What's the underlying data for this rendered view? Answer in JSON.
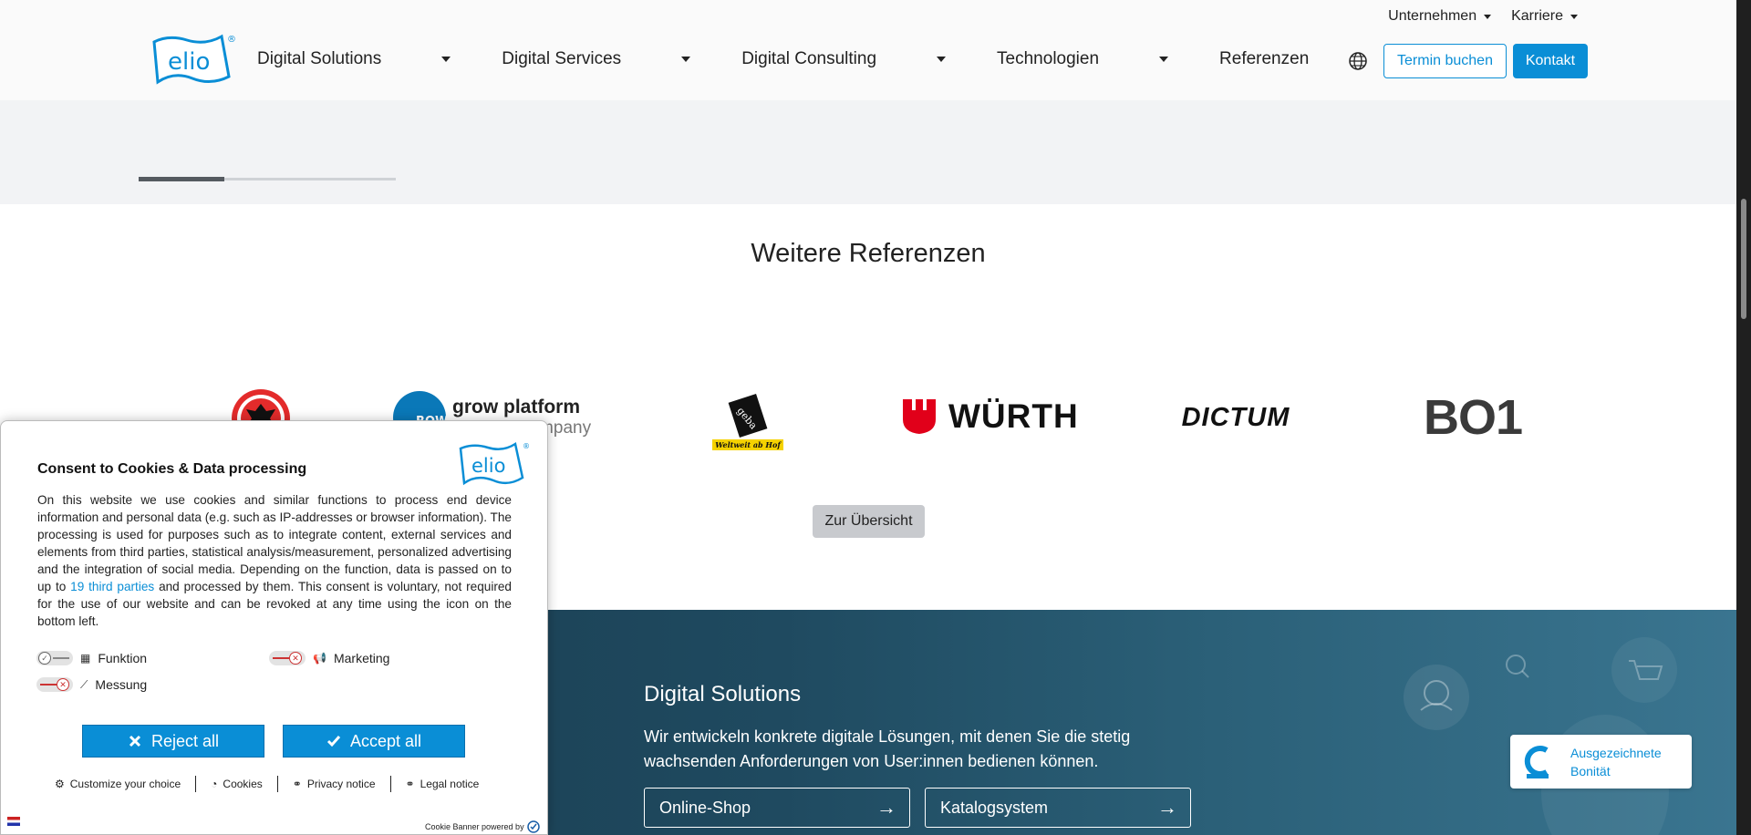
{
  "header": {
    "topnav": [
      {
        "label": "Unternehmen"
      },
      {
        "label": "Karriere"
      }
    ],
    "mainnav": [
      {
        "label": "Digital Solutions"
      },
      {
        "label": "Digital Services"
      },
      {
        "label": "Digital Consulting"
      },
      {
        "label": "Technologien"
      },
      {
        "label": "Referenzen"
      }
    ],
    "logo_text": "elio",
    "appointment_button": "Termin buchen",
    "contact_button": "Kontakt"
  },
  "references": {
    "title": "Weitere Referenzen",
    "logos": [
      {
        "name": "eintracht-frankfurt"
      },
      {
        "name": "grow platform",
        "title": "grow platform",
        "subtitle": "A Bosch company"
      },
      {
        "name": "gebana",
        "tagline": "Weltweit ab Hof"
      },
      {
        "name": "wurth",
        "text": "WÜRTH"
      },
      {
        "name": "dictum",
        "text": "DICTUM"
      },
      {
        "name": "bo1",
        "text": "BO1"
      }
    ],
    "overview_button": "Zur Übersicht"
  },
  "digital_solutions": {
    "title": "Digital Solutions",
    "text": "Wir entwickeln konkrete digitale Lösungen, mit denen Sie die stetig wachsenden Anforderungen von User:innen bedienen können.",
    "buttons": [
      {
        "label": "Online-Shop"
      },
      {
        "label": "Katalogsystem"
      }
    ]
  },
  "badge": {
    "line1": "Ausgezeichnete",
    "line2": "Bonität"
  },
  "cookie_banner": {
    "title": "Consent to Cookies & Data processing",
    "text_before_link": "On this website we use cookies and similar functions to process end device information and personal data (e.g. such as IP-addresses or browser information). The processing is used for purposes such as to integrate content, external services and elements from third parties, statistical analysis/measurement, personalized advertising and the integration of social media. Depending on the function, data is passed on to up to ",
    "link_text": "19 third parties",
    "text_after_link": " and processed by them. This consent is voluntary, not required for the use of our website and can be revoked at any time using the icon on the bottom left.",
    "toggles": [
      {
        "label": "Funktion",
        "state": "on"
      },
      {
        "label": "Marketing",
        "state": "off"
      },
      {
        "label": "Messung",
        "state": "off"
      }
    ],
    "reject_button": "Reject all",
    "accept_button": "Accept all",
    "links": [
      {
        "label": "Customize your choice"
      },
      {
        "label": "Cookies"
      },
      {
        "label": "Privacy notice"
      },
      {
        "label": "Legal notice"
      }
    ],
    "powered_by": "Cookie Banner powered by"
  },
  "colors": {
    "accent": "#0a8ed6",
    "dark_section": "#1f4a60",
    "grey_band": "#f2f3f5"
  }
}
